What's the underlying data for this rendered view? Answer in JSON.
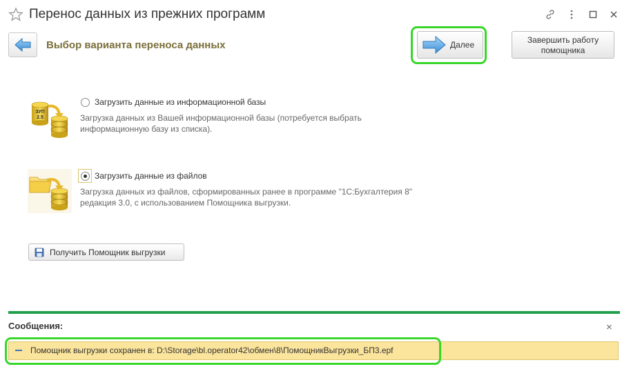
{
  "window": {
    "title": "Перенос данных из прежних программ"
  },
  "header": {
    "page_title": "Выбор варианта переноса данных",
    "next_label": "Далее",
    "finish_label_line1": "Завершить работу",
    "finish_label_line2": "помощника"
  },
  "options": [
    {
      "label": "Загрузить данные из информационной базы",
      "desc_line1": "Загрузка данных из Вашей информационной базы (потребуется выбрать",
      "desc_line2": "информационную базу из списка).",
      "icon_badge_1": "ЗУП",
      "icon_badge_2": "2.5",
      "selected": false
    },
    {
      "label": "Загрузить данные из файлов",
      "desc_line1": "Загрузка данных из файлов, сформированных ранее в программе \"1С:Бухгалтерия 8\"",
      "desc_line2": "редакция 3.0, с использованием Помощника выгрузки.",
      "selected": true
    }
  ],
  "get_helper_label": "Получить Помощник выгрузки",
  "messages": {
    "title": "Сообщения:",
    "items": [
      {
        "text": "Помощник выгрузки сохранен в: D:\\Storage\\bl.operator42\\обмен\\8\\ПомощникВыгрузки_БП3.epf"
      }
    ]
  },
  "colors": {
    "accent_green": "#1fa04a",
    "highlight": "#38d62a",
    "message_bg": "#fbe49b",
    "page_title": "#7b6f3a"
  }
}
